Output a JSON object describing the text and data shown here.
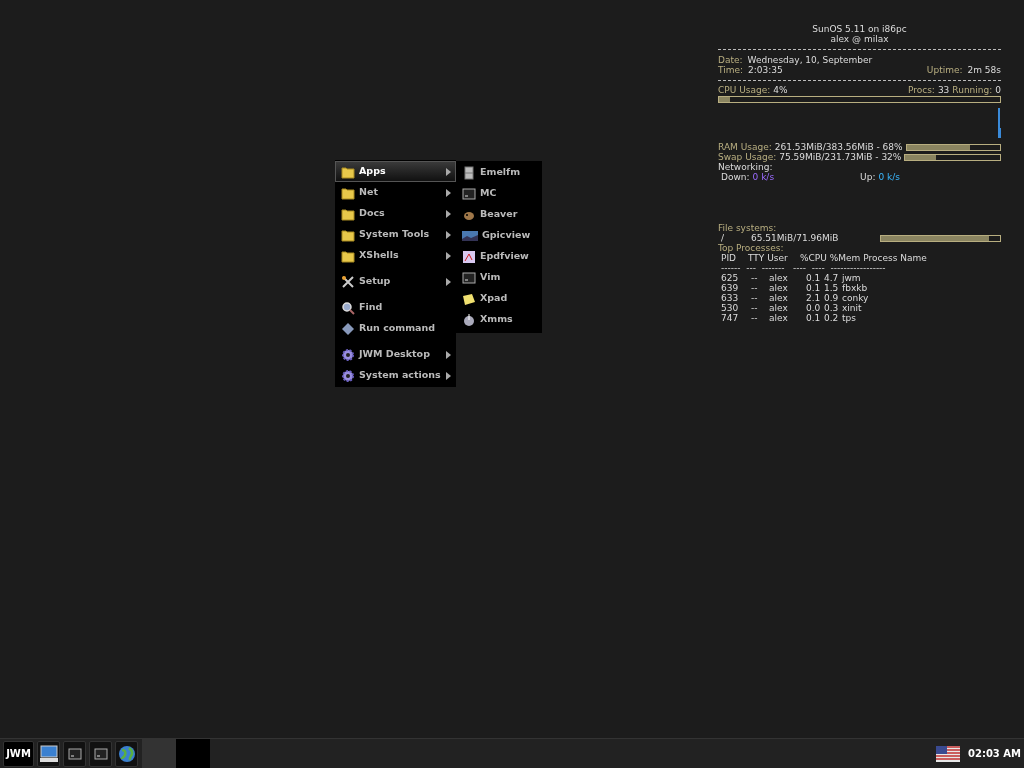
{
  "menu": {
    "groups": [
      [
        {
          "kind": "folder",
          "label": "Apps",
          "submenu": true,
          "selected": true
        },
        {
          "kind": "folder",
          "label": "Net",
          "submenu": true,
          "selected": false
        },
        {
          "kind": "folder",
          "label": "Docs",
          "submenu": true,
          "selected": false
        },
        {
          "kind": "folder",
          "label": "System Tools",
          "submenu": true,
          "selected": false
        },
        {
          "kind": "folder",
          "label": "XShells",
          "submenu": true,
          "selected": false
        }
      ],
      [
        {
          "kind": "tools",
          "label": "Setup",
          "submenu": true,
          "selected": false
        }
      ],
      [
        {
          "kind": "find",
          "label": "Find",
          "submenu": false,
          "selected": false
        },
        {
          "kind": "run",
          "label": "Run command",
          "submenu": false,
          "selected": false
        }
      ],
      [
        {
          "kind": "gear",
          "label": "JWM Desktop",
          "submenu": true,
          "selected": false
        },
        {
          "kind": "gear",
          "label": "System actions",
          "submenu": true,
          "selected": false
        }
      ]
    ]
  },
  "submenu": {
    "items": [
      {
        "kind": "cabinet",
        "label": "Emelfm"
      },
      {
        "kind": "terminal",
        "label": "MC"
      },
      {
        "kind": "beaver",
        "label": "Beaver"
      },
      {
        "kind": "image",
        "label": "Gpicview"
      },
      {
        "kind": "pdf",
        "label": "Epdfview"
      },
      {
        "kind": "terminal",
        "label": "Vim"
      },
      {
        "kind": "note",
        "label": "Xpad"
      },
      {
        "kind": "player",
        "label": "Xmms"
      }
    ]
  },
  "monitor": {
    "system": "SunOS 5.11 on i86pc",
    "user": "alex @ milax",
    "date_label": "Date:",
    "date": "Wednesday,  10,  September",
    "time_label": "Time:",
    "time": "2:03:35",
    "uptime_label": "Uptime:",
    "uptime": "2m 58s",
    "cpu_label": "CPU Usage:",
    "cpu": "4%",
    "cpu_bar": {
      "level": 0.04
    },
    "procs_label": "Procs:",
    "procs": "33",
    "running_label": "Running:",
    "running": "0",
    "ram_label": "RAM Usage:",
    "ram": "261.53MiB/383.56MiB - 68%",
    "ram_bar": {
      "level": 0.68
    },
    "swap_label": "Swap Usage:",
    "swap": "75.59MiB/231.73MiB - 32%",
    "swap_bar": {
      "level": 0.32
    },
    "net_label": "Networking:",
    "down_label": "Down:",
    "down": "0 k/s",
    "up_label": "Up:",
    "up": "0 k/s",
    "fs_label": "File systems:",
    "fs_mount": "/",
    "fs_usage": "65.51MiB/71.96MiB",
    "fs_bar": {
      "level": 0.91
    },
    "top_label": "Top Processes:",
    "columns": [
      "PID",
      "TTY User",
      "%CPU %Mem Process Name"
    ],
    "rule": "------  ---  -------   ----  ----  -----------------",
    "processes": [
      {
        "pid": "625",
        "tty": "--",
        "user": "alex",
        "cpu": "0.1",
        "mem": "4.7",
        "name": "jwm"
      },
      {
        "pid": "639",
        "tty": "--",
        "user": "alex",
        "cpu": "0.1",
        "mem": "1.5",
        "name": "fbxkb"
      },
      {
        "pid": "633",
        "tty": "--",
        "user": "alex",
        "cpu": "2.1",
        "mem": "0.9",
        "name": "conky"
      },
      {
        "pid": "530",
        "tty": "--",
        "user": "alex",
        "cpu": "0.0",
        "mem": "0.3",
        "name": "xinit"
      },
      {
        "pid": "747",
        "tty": "--",
        "user": "alex",
        "cpu": "0.1",
        "mem": "0.2",
        "name": "tps"
      }
    ]
  },
  "taskbar": {
    "start": "JWM",
    "launchers": [
      {
        "kind": "monitor"
      },
      {
        "kind": "terminal"
      },
      {
        "kind": "terminal"
      },
      {
        "kind": "globe"
      }
    ],
    "tasks": [
      {
        "selected": false
      },
      {
        "selected": true
      }
    ],
    "clock": "02:03 AM"
  }
}
